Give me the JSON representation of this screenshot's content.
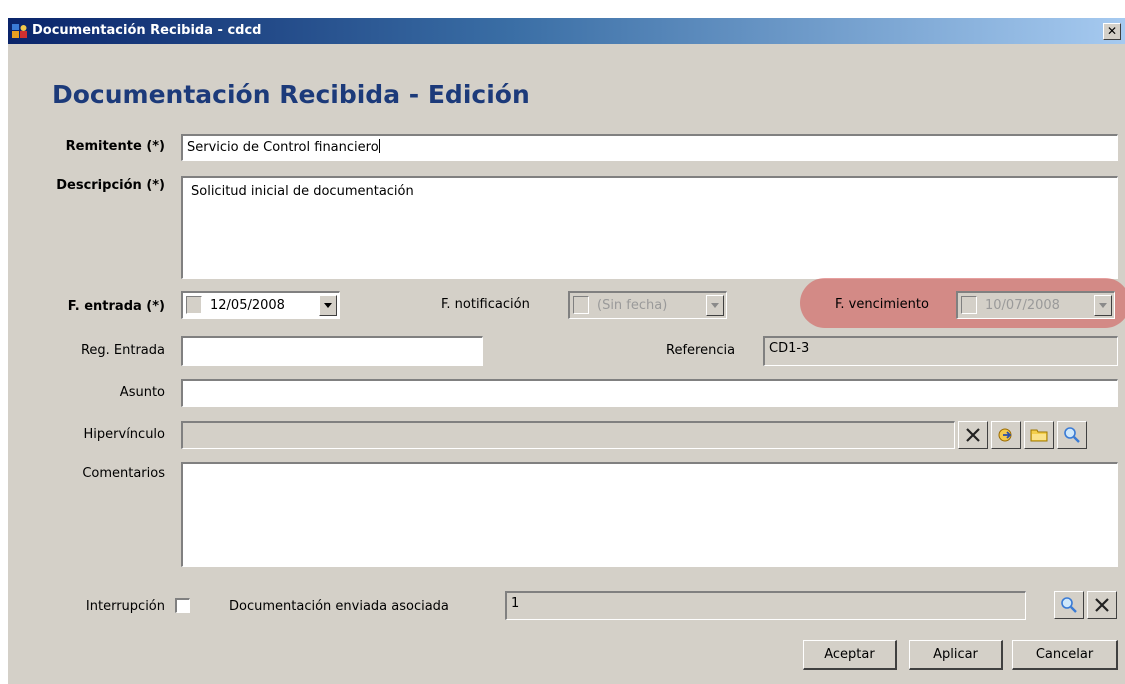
{
  "window": {
    "title": "Documentación Recibida - cdcd",
    "close_icon": "close-icon",
    "heading": "Documentación Recibida - Edición"
  },
  "form": {
    "remitente": {
      "label": "Remitente (*)",
      "value": "Servicio de Control financiero"
    },
    "descripcion": {
      "label": "Descripción (*)",
      "value": "Solicitud inicial de documentación"
    },
    "f_entrada": {
      "label": "F. entrada (*)",
      "value": "12/05/2008"
    },
    "f_notificacion": {
      "label": "F. notificación",
      "value": "(Sin fecha)"
    },
    "f_vencimiento": {
      "label": "F. vencimiento",
      "value": "10/07/2008"
    },
    "reg_entrada": {
      "label": "Reg. Entrada",
      "value": ""
    },
    "referencia": {
      "label": "Referencia",
      "value": "CD1-3"
    },
    "asunto": {
      "label": "Asunto",
      "value": ""
    },
    "hipervinculo": {
      "label": "Hipervínculo",
      "value": "",
      "icons": [
        "clear-icon",
        "link-icon",
        "folder-icon",
        "search-icon"
      ]
    },
    "comentarios": {
      "label": "Comentarios",
      "value": ""
    },
    "interrupcion": {
      "label": "Interrupción",
      "checked": false
    },
    "doc_enviada": {
      "label": "Documentación enviada asociada",
      "value": "1",
      "icons": [
        "search-icon",
        "clear-icon"
      ]
    }
  },
  "buttons": {
    "aceptar": "Aceptar",
    "aplicar": "Aplicar",
    "cancelar": "Cancelar"
  },
  "colors": {
    "heading": "#1c3a7a",
    "highlight": "#d25050",
    "face": "#d4d0c8"
  }
}
